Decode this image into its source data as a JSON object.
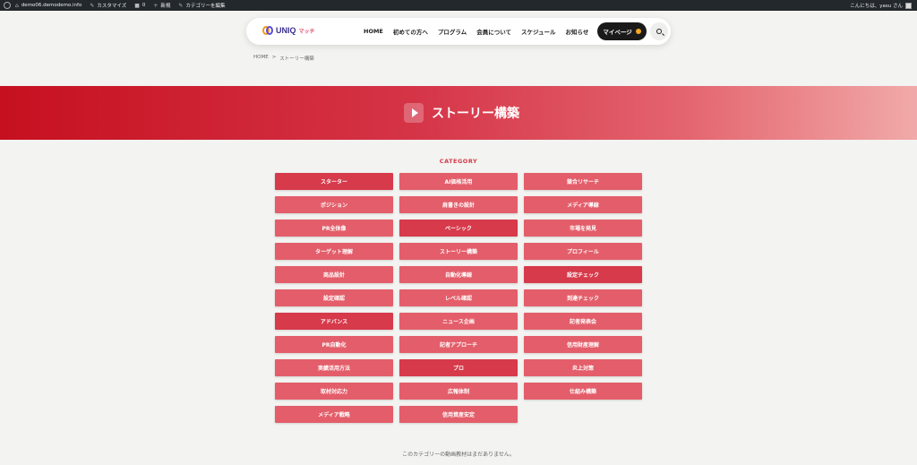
{
  "adminbar": {
    "site": "demo06.demodemo.info",
    "customize": "カスタマイズ",
    "comments": "0",
    "new": "新規",
    "edit_category": "カテゴリーを編集",
    "greeting": "こんにちは、yasu さん"
  },
  "header": {
    "logo_text": "UNIQ",
    "logo_sub": "マッチ",
    "nav": [
      "HOME",
      "初めての方へ",
      "プログラム",
      "会員について",
      "スケジュール",
      "お知らせ"
    ],
    "mypage": "マイページ"
  },
  "breadcrumb": {
    "home": "HOME",
    "sep": ">",
    "current": "ストーリー構築"
  },
  "hero": {
    "title": "ストーリー構築"
  },
  "category": {
    "heading": "CATEGORY",
    "items": [
      {
        "label": "スターター",
        "dark": true
      },
      {
        "label": "AI価格活用",
        "dark": false
      },
      {
        "label": "競合リサーチ",
        "dark": false
      },
      {
        "label": "ポジション",
        "dark": false
      },
      {
        "label": "肩書きの設計",
        "dark": false
      },
      {
        "label": "メディア導線",
        "dark": false
      },
      {
        "label": "PR全体像",
        "dark": false
      },
      {
        "label": "ベーシック",
        "dark": true
      },
      {
        "label": "市場を発見",
        "dark": false
      },
      {
        "label": "ターゲット理解",
        "dark": false
      },
      {
        "label": "ストーリー構築",
        "dark": false
      },
      {
        "label": "プロフィール",
        "dark": false
      },
      {
        "label": "商品設計",
        "dark": false
      },
      {
        "label": "自動化導線",
        "dark": false
      },
      {
        "label": "設定チェック",
        "dark": true
      },
      {
        "label": "設定確認",
        "dark": false
      },
      {
        "label": "レベル確認",
        "dark": false
      },
      {
        "label": "到達チェック",
        "dark": false
      },
      {
        "label": "アドバンス",
        "dark": true
      },
      {
        "label": "ニュース企画",
        "dark": false
      },
      {
        "label": "記者発表会",
        "dark": false
      },
      {
        "label": "PR自動化",
        "dark": false
      },
      {
        "label": "記者アプローチ",
        "dark": false
      },
      {
        "label": "信用財産理解",
        "dark": false
      },
      {
        "label": "実績活用方法",
        "dark": false
      },
      {
        "label": "プロ",
        "dark": true
      },
      {
        "label": "炎上対策",
        "dark": false
      },
      {
        "label": "取材対応力",
        "dark": false
      },
      {
        "label": "広報体制",
        "dark": false
      },
      {
        "label": "仕組み構築",
        "dark": false
      },
      {
        "label": "メディア戦略",
        "dark": false
      },
      {
        "label": "信用資産安定",
        "dark": false
      }
    ]
  },
  "empty_message": "このカテゴリーの動画教材はまだありません。",
  "colors": {
    "accent": "#d63a4b",
    "button": "#e35e6a",
    "dark": "#1a1a1a"
  }
}
